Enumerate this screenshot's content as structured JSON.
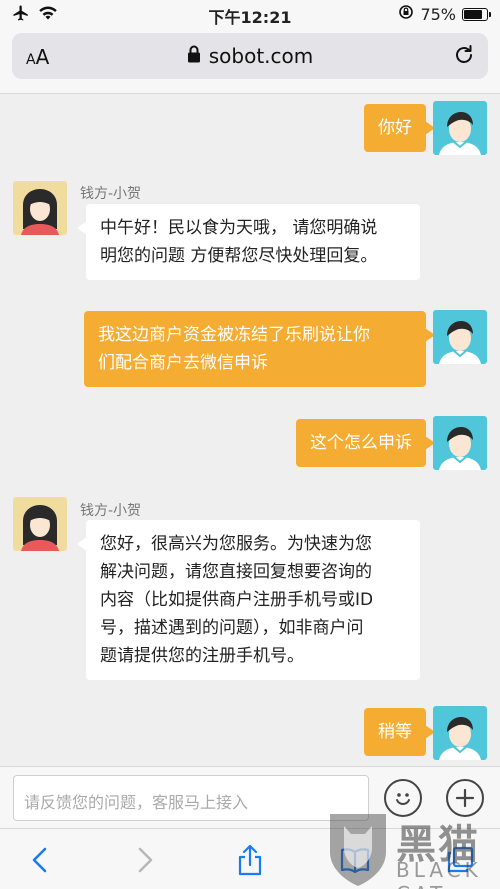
{
  "status_bar": {
    "time": "下午12:21",
    "battery": "75%"
  },
  "browser": {
    "text_size_label": "AA",
    "url": "sobot.com"
  },
  "chat": {
    "messages": [
      {
        "from": "user",
        "text": "你好"
      },
      {
        "from": "agent",
        "name": "钱方-小贺",
        "lines": [
          "中午好！民以食为天哦， 请您明确说",
          "明您的问题 方便帮您尽快处理回复。"
        ]
      },
      {
        "from": "user",
        "lines": [
          "我这边商户资金被冻结了乐刷说让你",
          "们配合商户去微信申诉"
        ]
      },
      {
        "from": "user",
        "text": "这个怎么申诉"
      },
      {
        "from": "agent",
        "name": "钱方-小贺",
        "lines": [
          "您好，很高兴为您服务。为快速为您",
          "解决问题，请您直接回复想要咨询的",
          "内容（比如提供商户注册手机号或ID",
          "号，描述遇到的问题），如非商户问",
          "题请提供您的注册手机号。"
        ]
      },
      {
        "from": "user",
        "text": "稍等"
      }
    ]
  },
  "composer": {
    "placeholder": "请反馈您的问题，客服马上接入"
  },
  "icons": {
    "airplane": "airplane-icon",
    "wifi": "wifi-icon",
    "lock": "lock-icon",
    "reload": "reload-icon",
    "emoji": "smiley-icon",
    "add": "plus-icon",
    "back": "chevron-left-icon",
    "forward": "chevron-right-icon",
    "share": "share-icon",
    "bookmarks": "book-icon",
    "tabs": "tabs-icon"
  },
  "watermark": {
    "logo_text": "黑猫",
    "sub": "BLACK CAT"
  },
  "colors": {
    "user_bubble": "#f5ac32",
    "agent_bubble": "#ffffff",
    "accent_blue": "#1a7cf5"
  }
}
